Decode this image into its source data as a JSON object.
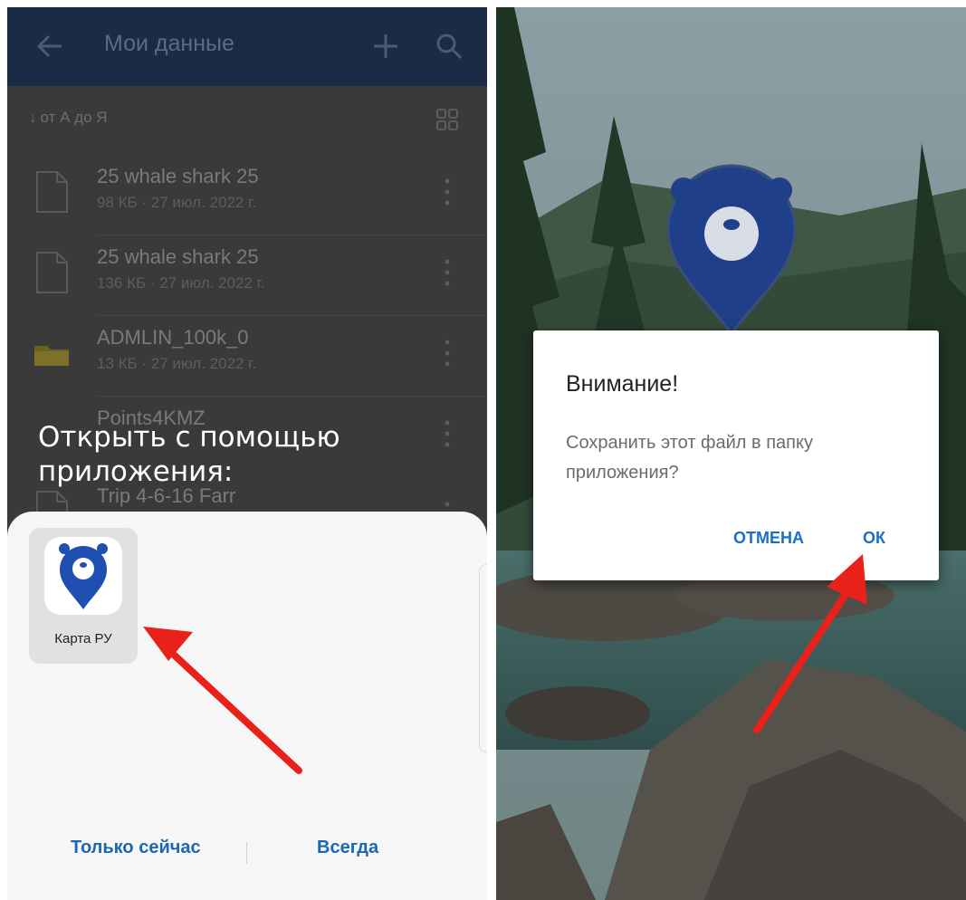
{
  "left": {
    "appbar": {
      "title": "Мои данные",
      "back_icon": "arrow-left-icon",
      "add_icon": "plus-icon",
      "search_icon": "search-icon"
    },
    "sort": {
      "arrow": "↓",
      "label": "от А до Я",
      "view_icon": "grid-view-icon"
    },
    "files": [
      {
        "name": "25 whale shark 25",
        "meta": "98 КБ · 27 июл. 2022 г.",
        "icon": "file-icon"
      },
      {
        "name": "25 whale shark 25",
        "meta": "136 КБ · 27 июл. 2022 г.",
        "icon": "file-icon"
      },
      {
        "name": "ADMLIN_100k_0",
        "meta": "13 КБ · 27 июл. 2022 г.",
        "icon": "folder-icon"
      },
      {
        "name": "Points4KMZ",
        "meta": "",
        "icon": "file-icon"
      },
      {
        "name": "Trip 4-6-16 Farr",
        "meta": "",
        "icon": "file-icon"
      }
    ],
    "open_with": {
      "line1": "Открыть с помощью",
      "line2": "приложения:"
    },
    "sheet": {
      "app_label": "Карта РУ",
      "just_once": "Только сейчас",
      "always": "Всегда"
    }
  },
  "right": {
    "dialog": {
      "title": "Внимание!",
      "message": "Сохранить этот файл в папку приложения?",
      "cancel": "ОТМЕНА",
      "ok": "ОК"
    }
  },
  "colors": {
    "accent": "#1a67b3",
    "arrow": "#e8221b",
    "brand_blue": "#1f4fb0"
  }
}
